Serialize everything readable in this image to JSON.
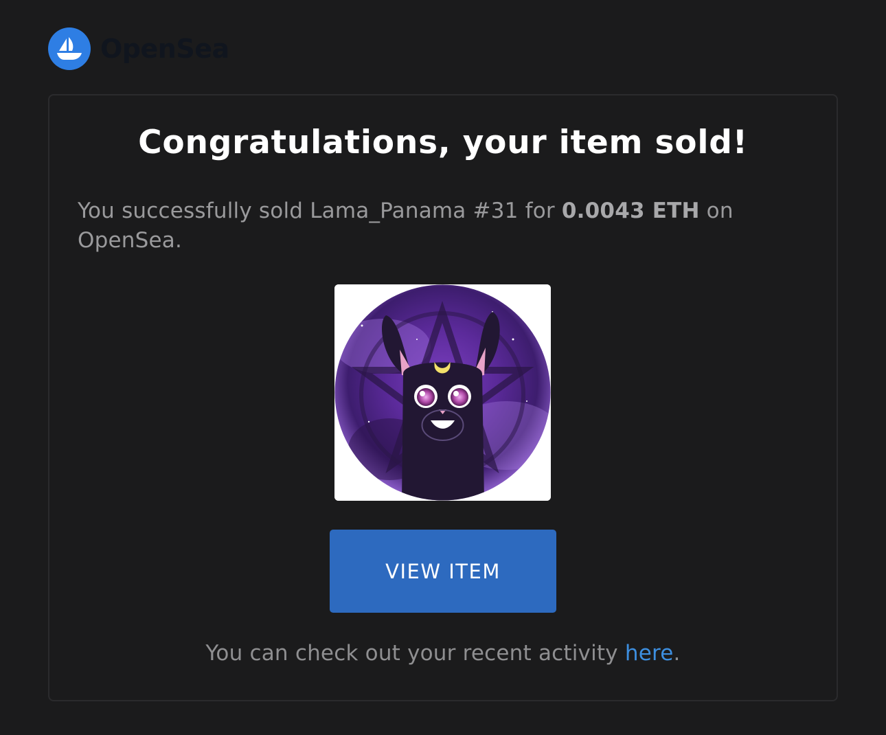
{
  "brand": {
    "name": "OpenSea",
    "logo_icon": "opensea-ship-icon",
    "accent_color": "#2e7ee4"
  },
  "email": {
    "title": "Congratulations, your item sold!",
    "message_prefix": "You successfully sold Lama_Panama #31 for ",
    "price": "0.0043 ETH",
    "message_suffix": " on OpenSea.",
    "item_image": "lama-panama-31-nft-image",
    "button_label": "VIEW ITEM",
    "button_color": "#2d6abf",
    "footer_prefix": "You can check out your recent activity ",
    "footer_link": "here",
    "footer_suffix": ".",
    "link_color": "#3d8fe0"
  }
}
